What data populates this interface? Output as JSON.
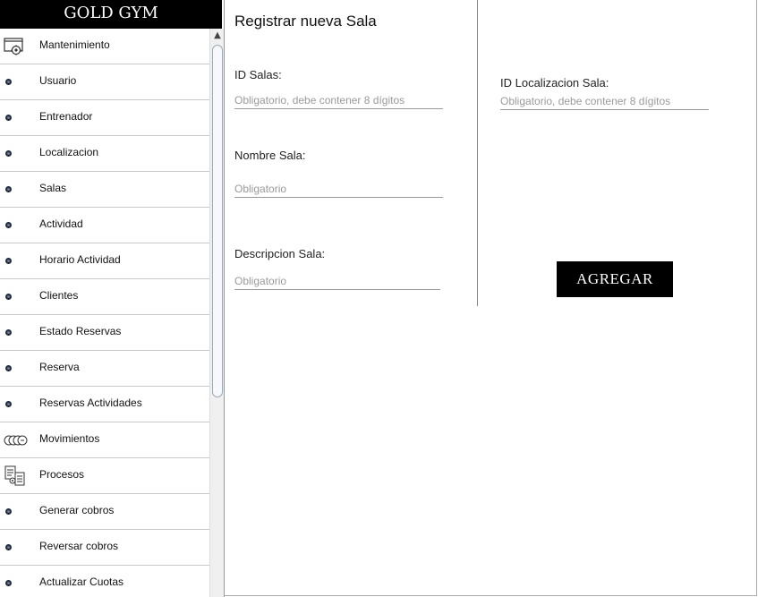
{
  "app": {
    "brand": "GOLD GYM"
  },
  "sidebar": {
    "items": [
      {
        "label": "Mantenimiento",
        "icon": "settings-window-icon"
      },
      {
        "label": "Usuario",
        "icon": "bullet-icon"
      },
      {
        "label": "Entrenador",
        "icon": "bullet-icon"
      },
      {
        "label": "Localizacion",
        "icon": "bullet-icon"
      },
      {
        "label": "Salas",
        "icon": "bullet-icon"
      },
      {
        "label": "Actividad",
        "icon": "bullet-icon"
      },
      {
        "label": "Horario Actividad",
        "icon": "bullet-icon"
      },
      {
        "label": "Clientes",
        "icon": "bullet-icon"
      },
      {
        "label": "Estado Reservas",
        "icon": "bullet-icon"
      },
      {
        "label": "Reserva",
        "icon": "bullet-icon"
      },
      {
        "label": "Reservas Actividades",
        "icon": "bullet-icon"
      },
      {
        "label": "Movimientos",
        "icon": "coins-icon"
      },
      {
        "label": "Procesos",
        "icon": "documents-gear-icon"
      },
      {
        "label": "Generar cobros",
        "icon": "bullet-icon"
      },
      {
        "label": "Reversar cobros",
        "icon": "bullet-icon"
      },
      {
        "label": "Actualizar Cuotas",
        "icon": "bullet-icon"
      }
    ]
  },
  "form": {
    "title": "Registrar nueva Sala",
    "id_salas": {
      "label": "ID Salas:",
      "placeholder": "Obligatorio, debe contener 8 dígitos",
      "value": ""
    },
    "nombre_sala": {
      "label": "Nombre Sala:",
      "placeholder": "Obligatorio",
      "value": ""
    },
    "descripcion_sala": {
      "label": "Descripcion Sala:",
      "placeholder": "Obligatorio",
      "value": ""
    },
    "id_localizacion_sala": {
      "label": "ID Localizacion Sala:",
      "placeholder": "Obligatorio, debe contener 8 dígitos",
      "value": ""
    },
    "submit_label": "AGREGAR"
  },
  "colors": {
    "brand_bg": "#000000",
    "button_bg": "#000000",
    "bullet": "#1f2d3f"
  }
}
